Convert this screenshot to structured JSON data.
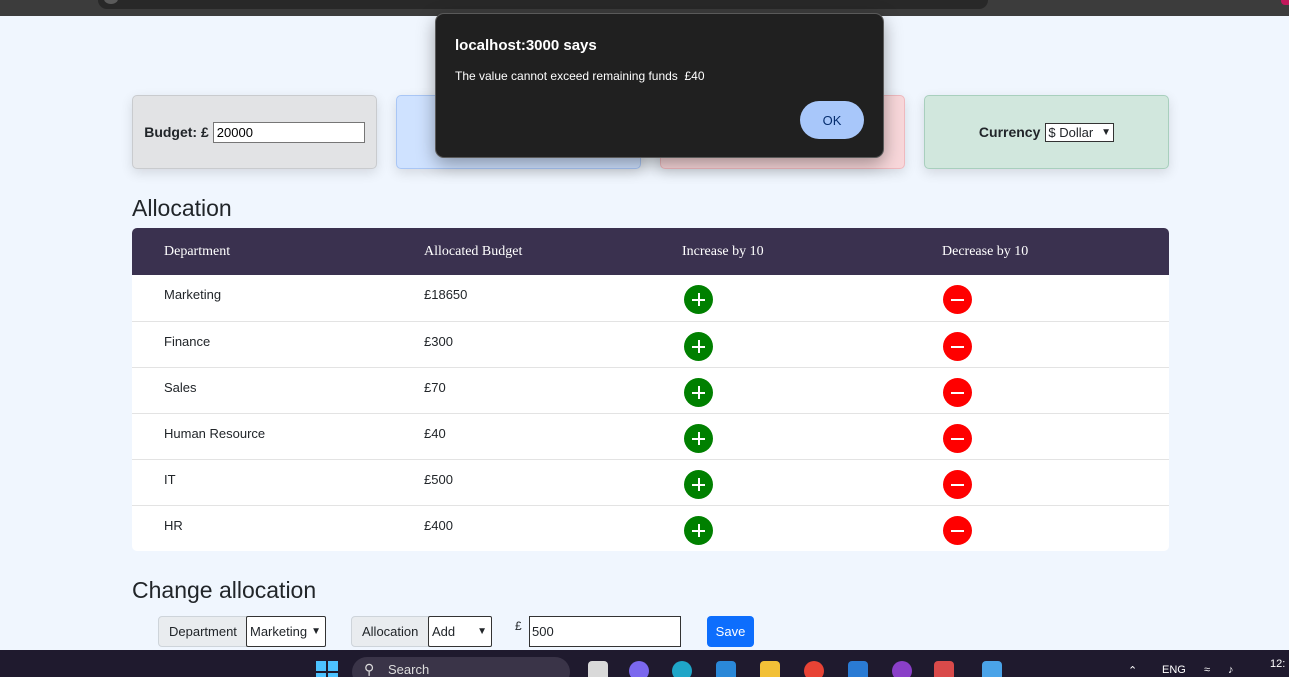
{
  "dialog": {
    "title": "localhost:3000 says",
    "message": "The value cannot exceed remaining funds  £40",
    "ok_label": "OK"
  },
  "cards": {
    "budget_label": "Budget: £",
    "budget_value": "20000",
    "currency_label": "Currency",
    "currency_value": "$ Dollar"
  },
  "allocation": {
    "heading": "Allocation",
    "columns": [
      "Department",
      "Allocated Budget",
      "Increase by 10",
      "Decrease by 10"
    ],
    "rows": [
      {
        "department": "Marketing",
        "budget": "£18650"
      },
      {
        "department": "Finance",
        "budget": "£300"
      },
      {
        "department": "Sales",
        "budget": "£70"
      },
      {
        "department": "Human Resource",
        "budget": "£40"
      },
      {
        "department": "IT",
        "budget": "£500"
      },
      {
        "department": "HR",
        "budget": "£400"
      }
    ]
  },
  "change_allocation": {
    "heading": "Change allocation",
    "department_label": "Department",
    "department_value": "Marketing",
    "allocation_label": "Allocation",
    "allocation_value": "Add",
    "currency_symbol": "£",
    "amount_value": "500",
    "save_label": "Save"
  },
  "taskbar": {
    "search_label": "Search",
    "language": "ENG",
    "clock": "12:"
  },
  "colors": {
    "increase": "#008000",
    "decrease": "#ff0000",
    "table_header": "#3a314f",
    "save_button": "#0d6efd"
  }
}
